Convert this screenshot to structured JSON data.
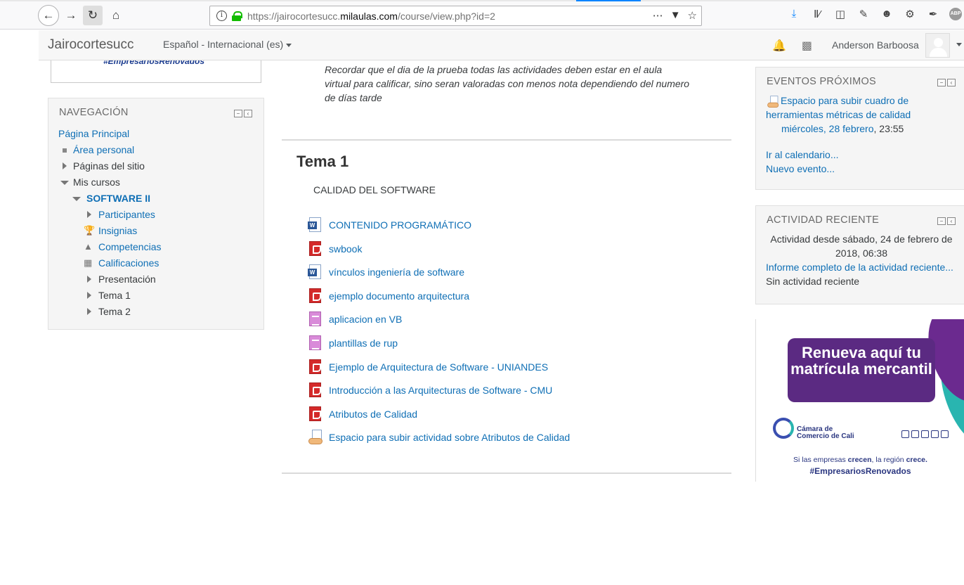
{
  "browser": {
    "url_prefix": "https://jairocortesucc.",
    "url_domain": "milaulas.com",
    "url_suffix": "/course/view.php?id=2",
    "icons": [
      "back-icon",
      "forward-icon",
      "reload-icon",
      "home-icon",
      "info-icon",
      "lock-icon",
      "more-icon",
      "pocket-icon",
      "bookmark-star-icon",
      "download-icon",
      "library-icon",
      "sidebar-icon",
      "paint-icon",
      "people-icon",
      "settings-icon",
      "eyedropper-icon",
      "adblock-icon"
    ],
    "adblock_label": "ABP"
  },
  "navbar": {
    "brand": "Jairocortesucc",
    "language": "Español - Internacional (es)",
    "username": "Anderson Barboosa"
  },
  "top_block": {
    "hashtag": "#EmpresariosRenovados"
  },
  "navigation": {
    "title": "NAVEGACIÓN",
    "home": "Página Principal",
    "personal_area": "Área personal",
    "site_pages": "Páginas del sitio",
    "my_courses": "Mis cursos",
    "course": "SOFTWARE II",
    "participants": "Participantes",
    "badges": "Insignias",
    "competencies": "Competencias",
    "grades": "Calificaciones",
    "presentation": "Presentación",
    "topic1": "Tema 1",
    "topic2": "Tema 2"
  },
  "main": {
    "intro": "Recordar que el dia de la prueba todas las actividades deben estar en el aula virtual para calificar, sino seran valoradas con menos nota dependiendo del numero de días tarde",
    "section_title": "Tema 1",
    "section_summary": "CALIDAD DEL SOFTWARE",
    "activities": [
      {
        "label": "CONTENIDO PROGRAMÁTICO",
        "icon": "word-document-icon"
      },
      {
        "label": "swbook",
        "icon": "pdf-icon"
      },
      {
        "label": "vínculos ingeniería de software",
        "icon": "word-document-icon"
      },
      {
        "label": "ejemplo documento arquitectura",
        "icon": "pdf-icon"
      },
      {
        "label": "aplicacion en VB",
        "icon": "text-file-icon"
      },
      {
        "label": "plantillas de rup",
        "icon": "text-file-icon"
      },
      {
        "label": "Ejemplo de Arquitectura de Software - UNIANDES",
        "icon": "pdf-icon"
      },
      {
        "label": "Introducción a las Arquitecturas de Software - CMU",
        "icon": "pdf-icon"
      },
      {
        "label": "Atributos de Calidad",
        "icon": "pdf-icon"
      },
      {
        "label": "Espacio para subir actividad sobre Atributos de Calidad",
        "icon": "assignment-icon"
      }
    ]
  },
  "upcoming": {
    "title": "EVENTOS PRÓXIMOS",
    "event_title": "Espacio para subir cuadro de herramientas métricas de calidad",
    "event_date": "miércoles, 28 febrero",
    "event_time": ", 23:55",
    "calendar_link": "Ir al calendario...",
    "new_event_link": "Nuevo evento..."
  },
  "recent": {
    "title": "ACTIVIDAD RECIENTE",
    "since": "Actividad desde sábado, 24 de febrero de 2018, 06:38",
    "full_report": "Informe completo de la actividad reciente...",
    "none": "Sin actividad reciente"
  },
  "ad": {
    "headline": "Renueva aquí tu matrícula mercantil",
    "org_line1": "Cámara de",
    "org_line2": "Comercio de Cali",
    "slogan_a": "Si las empresas ",
    "slogan_b": "crecen",
    "slogan_c": ", la región ",
    "slogan_d": "crece.",
    "hashtag": "#EmpresariosRenovados"
  },
  "colors": {
    "link": "#0f6fb5",
    "block_bg": "#f5f5f5",
    "navbar_bg": "#f7f7f7",
    "ad_purple": "#5b2a82"
  }
}
